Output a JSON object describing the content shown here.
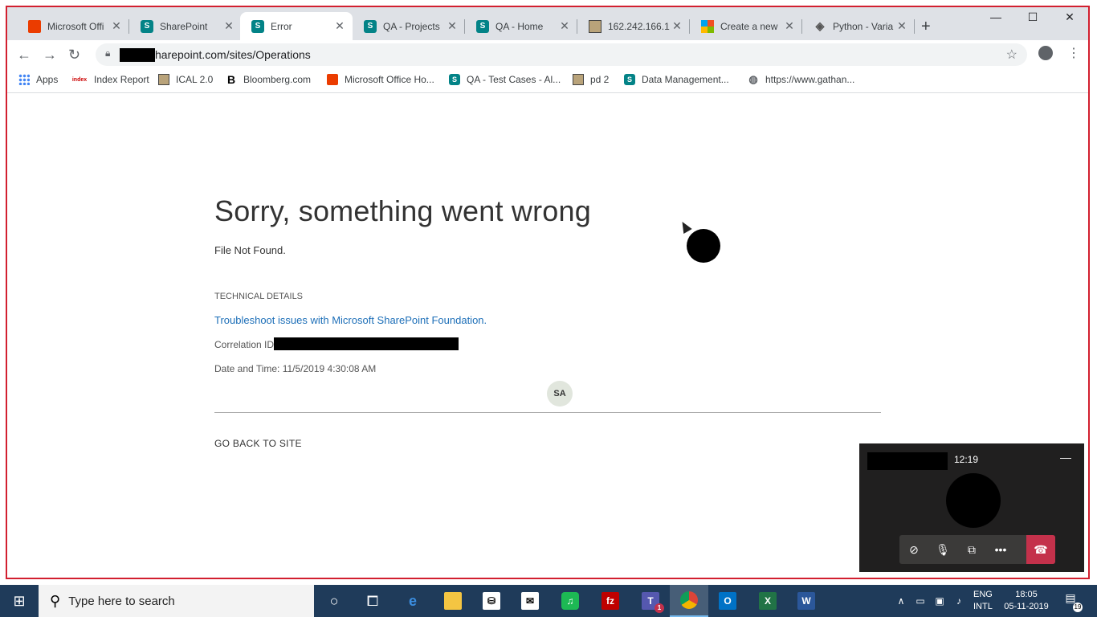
{
  "browser": {
    "tabs": [
      {
        "title": "Microsoft Offi",
        "icon": "office-icon"
      },
      {
        "title": "SharePoint",
        "icon": "sharepoint-icon"
      },
      {
        "title": "Error",
        "icon": "sharepoint-icon",
        "active": true
      },
      {
        "title": "QA - Projects",
        "icon": "sharepoint-icon"
      },
      {
        "title": "QA - Home",
        "icon": "sharepoint-icon"
      },
      {
        "title": "162.242.166.1",
        "icon": "image-icon"
      },
      {
        "title": "Create a new",
        "icon": "microsoft-icon"
      },
      {
        "title": "Python - Varia",
        "icon": "python-icon"
      }
    ],
    "new_tab": "+",
    "url": "harepoint.com/sites/Operations",
    "bookmarks": [
      {
        "label": "Apps"
      },
      {
        "label": "Index Report",
        "icon_text": "index"
      },
      {
        "label": "ICAL 2.0"
      },
      {
        "label": "Bloomberg.com",
        "icon_text": "B"
      },
      {
        "label": "Microsoft Office Ho..."
      },
      {
        "label": "QA - Test Cases - Al..."
      },
      {
        "label": "pd 2"
      },
      {
        "label": "Data Management..."
      },
      {
        "label": "https://www.gathan..."
      }
    ]
  },
  "page": {
    "heading": "Sorry, something went wrong",
    "message": "File Not Found.",
    "tech_label": "TECHNICAL DETAILS",
    "troubleshoot_link": "Troubleshoot issues with Microsoft SharePoint Foundation.",
    "correlation_label": "Correlation ID:",
    "date_time": "Date and Time: 11/5/2019 4:30:08 AM",
    "avatar": "SA",
    "go_back": "GO BACK TO SITE"
  },
  "call": {
    "duration": "12:19",
    "minimize": "—"
  },
  "taskbar": {
    "search_placeholder": "Type here to search",
    "lang_top": "ENG",
    "lang_bottom": "INTL",
    "time": "18:05",
    "date": "05-11-2019",
    "notification_count": "19",
    "teams_badge": "1"
  },
  "colors": {
    "frame_border": "#d21f2f",
    "link": "#1d6fb8",
    "sharepoint": "#038387",
    "hangup": "#c4314b",
    "taskbar": "#1f3b5a"
  }
}
